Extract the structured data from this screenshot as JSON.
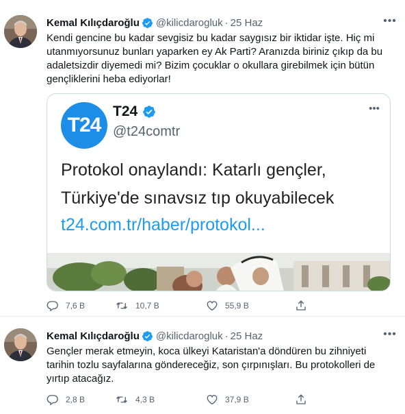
{
  "tweets": [
    {
      "author": {
        "name": "Kemal Kılıçdaroğlu",
        "handle": "@kilicdarogluk",
        "date": "25 Haz",
        "verified": true
      },
      "text": "Kendi gencine bu kadar sevgisiz bu kadar saygısız bir iktidar işte. Hiç mi utanmıyorsunuz bunları yaparken ey Ak Parti? Aranızda biriniz çıkıp da bu adaletsizdir diyemedi mi? Bizim çocuklar o okullara girebilmek için bütün gençliklerini heba ediyorlar!",
      "quote": {
        "logo_text": "T24",
        "name": "T24",
        "handle": "@t24comtr",
        "headline_line1": "Protokol onaylandı: Katarlı gençler,",
        "headline_line2": "Türkiye'de sınavsız tıp okuyabilecek",
        "link": "t24.com.tr/haber/protokol..."
      },
      "actions": {
        "reply_count": "7,6 B",
        "retweet_count": "10,7 B",
        "like_count": "55,9 B"
      }
    },
    {
      "author": {
        "name": "Kemal Kılıçdaroğlu",
        "handle": "@kilicdarogluk",
        "date": "25 Haz",
        "verified": true
      },
      "text": "Gençler merak etmeyin, koca ülkeyi Kataristan'a döndüren bu zihniyeti tarihin tozlu sayfalarına göndereceğiz, son çırpınışları. Bu protokolleri de yırtıp atacağız.",
      "actions": {
        "reply_count": "2,8 B",
        "retweet_count": "4,3 B",
        "like_count": "37,9 B"
      }
    }
  ],
  "ui": {
    "separator": "·",
    "more_glyph": "•••"
  },
  "colors": {
    "accent": "#1d9bf0",
    "t24_brand": "#1d8ee8",
    "secondary_text": "#536471"
  },
  "icons": [
    "verified-badge-icon",
    "more-icon",
    "reply-icon",
    "retweet-icon",
    "like-icon",
    "share-icon"
  ]
}
